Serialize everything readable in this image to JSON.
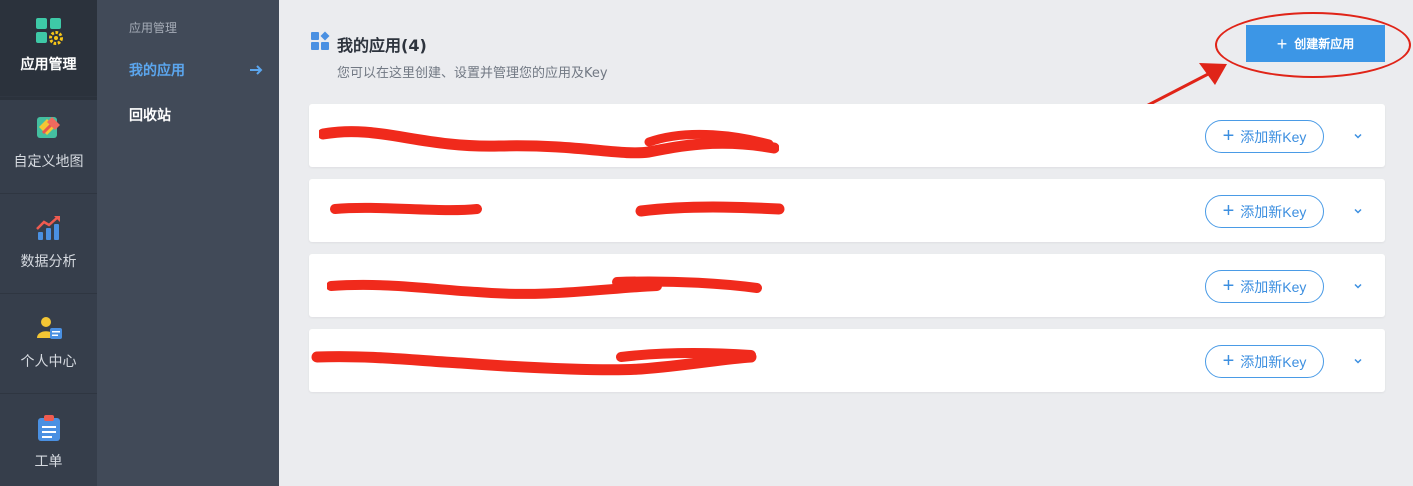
{
  "rail": {
    "items": [
      {
        "label": "应用管理",
        "icon": "apps-gear-icon",
        "active": true
      },
      {
        "label": "自定义地图",
        "icon": "custom-map-icon"
      },
      {
        "label": "数据分析",
        "icon": "data-analysis-icon"
      },
      {
        "label": "个人中心",
        "icon": "user-center-icon"
      },
      {
        "label": "工单",
        "icon": "work-order-icon"
      }
    ]
  },
  "subnav": {
    "title": "应用管理",
    "items": [
      {
        "label": "我的应用",
        "active": true
      },
      {
        "label": "回收站"
      }
    ]
  },
  "header": {
    "title": "我的应用(4)",
    "description": "您可以在这里创建、设置并管理您的应用及Key",
    "create_button": "创建新应用"
  },
  "apps": [
    {
      "name": "",
      "date": "",
      "add_key_label": "添加新Key"
    },
    {
      "name": "",
      "date": "",
      "add_key_label": "添加新Key"
    },
    {
      "name": "",
      "date": "",
      "add_key_label": "添加新Key"
    },
    {
      "name": "",
      "date": "",
      "add_key_label": "添加新Key"
    }
  ],
  "colors": {
    "accent": "#3c96e6",
    "rail_bg": "#363e4b",
    "subnav_bg": "#414a58",
    "annotation_red": "#e02418"
  }
}
